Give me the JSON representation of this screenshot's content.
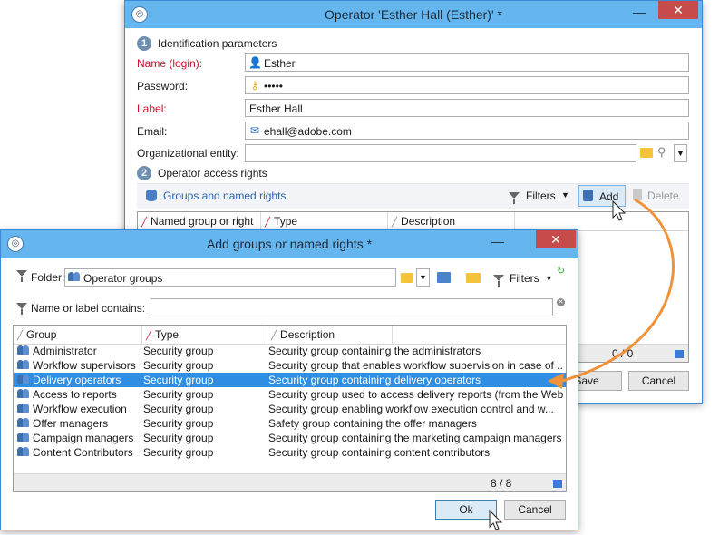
{
  "operator_window": {
    "title": "Operator 'Esther Hall (Esther)' *",
    "section1_title": "Identification parameters",
    "section1_num": "1",
    "name_label": "Name (login):",
    "name_value": "Esther",
    "password_label": "Password:",
    "password_value": "•••••",
    "label_label": "Label:",
    "label_value": "Esther Hall",
    "email_label": "Email:",
    "email_value": "ehall@adobe.com",
    "org_label": "Organizational entity:",
    "org_value": "",
    "section2_title": "Operator access rights",
    "section2_num": "2",
    "groups_link": "Groups and named rights",
    "filters_label": "Filters",
    "add_label": "Add",
    "delete_label": "Delete",
    "columns": [
      "Named group or right",
      "Type",
      "Description"
    ],
    "count": "0 / 0",
    "save_label": "Save",
    "cancel_label": "Cancel"
  },
  "add_dialog": {
    "title": "Add groups or named rights *",
    "folder_label": "Folder:",
    "folder_value": "Operator groups",
    "filters_label": "Filters",
    "name_filter_label": "Name or label contains:",
    "name_filter_value": "",
    "columns": [
      "Group",
      "Type",
      "Description"
    ],
    "rows": [
      {
        "group": "Administrator",
        "type": "Security group",
        "desc": "Security group containing the administrators"
      },
      {
        "group": "Workflow supervisors",
        "type": "Security group",
        "desc": "Security group that enables workflow supervision in case of ..."
      },
      {
        "group": "Delivery operators",
        "type": "Security group",
        "desc": "Security group containing delivery operators"
      },
      {
        "group": "Access to reports",
        "type": "Security group",
        "desc": "Security group used to access delivery reports (from the Web..."
      },
      {
        "group": "Workflow execution",
        "type": "Security group",
        "desc": "Security group enabling workflow execution control and w..."
      },
      {
        "group": "Offer managers",
        "type": "Security group",
        "desc": "Safety group containing the offer managers"
      },
      {
        "group": "Campaign managers",
        "type": "Security group",
        "desc": "Security group containing the marketing campaign managers"
      },
      {
        "group": "Content Contributors",
        "type": "Security group",
        "desc": "Security group containing content contributors"
      }
    ],
    "selected_index": 2,
    "count": "8 / 8",
    "ok_label": "Ok",
    "cancel_label": "Cancel"
  },
  "colors": {
    "titlebar": "#65b5ee",
    "selection": "#2f8ee3",
    "required_label": "#c8102e",
    "link": "#2a62b0",
    "arrow": "#f0923a"
  }
}
